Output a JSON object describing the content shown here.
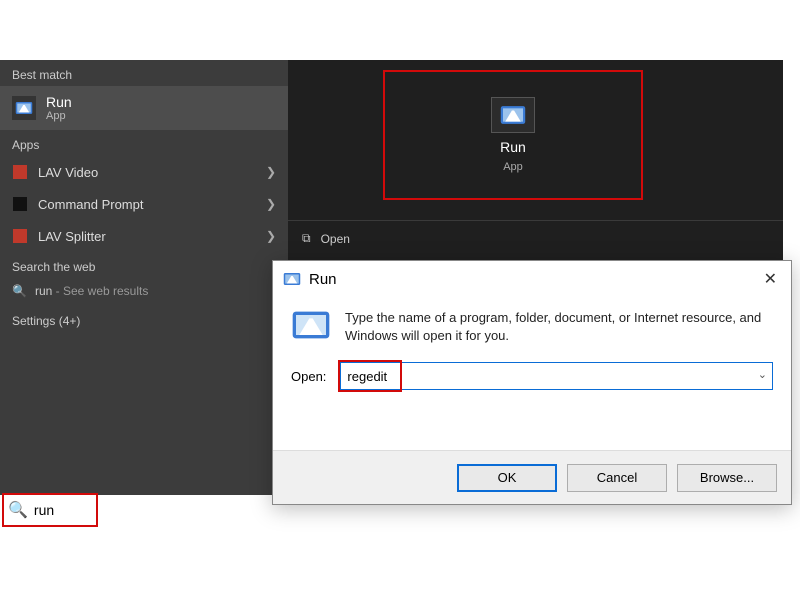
{
  "start": {
    "best_match_label": "Best match",
    "best_match": {
      "title": "Run",
      "subtitle": "App"
    },
    "apps_label": "Apps",
    "apps": [
      {
        "name": "LAV Video"
      },
      {
        "name": "Command Prompt"
      },
      {
        "name": "LAV Splitter"
      }
    ],
    "web_label": "Search the web",
    "web_item": {
      "term": "run",
      "suffix": " - See web results"
    },
    "settings_label": "Settings (4+)",
    "search_value": "run"
  },
  "preview": {
    "title": "Run",
    "subtitle": "App",
    "open_label": "Open"
  },
  "run_dialog": {
    "title": "Run",
    "description": "Type the name of a program, folder, document, or Internet resource, and Windows will open it for you.",
    "open_label": "Open:",
    "open_value": "regedit",
    "buttons": {
      "ok": "OK",
      "cancel": "Cancel",
      "browse": "Browse..."
    }
  }
}
